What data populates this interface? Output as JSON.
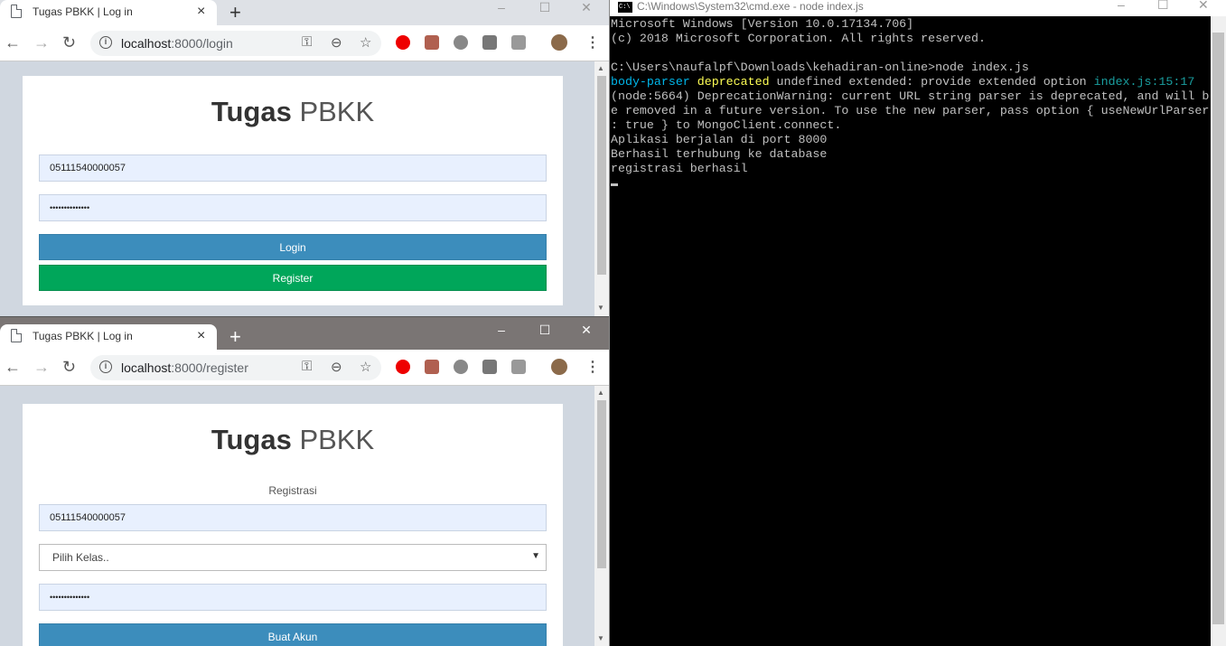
{
  "top_browser": {
    "tab_title": "Tugas PBKK | Log in",
    "url_host": "localhost",
    "url_path": ":8000/login",
    "brand_bold": "Tugas",
    "brand_light": "PBKK",
    "username_value": "05111540000057",
    "password_value": "••••••••••••••",
    "login_label": "Login",
    "register_label": "Register"
  },
  "bottom_browser": {
    "tab_title": "Tugas PBKK | Log in",
    "url_host": "localhost",
    "url_path": ":8000/register",
    "brand_bold": "Tugas",
    "brand_light": "PBKK",
    "heading": "Registrasi",
    "username_value": "05111540000057",
    "class_select_value": "Pilih Kelas..",
    "password_value": "••••••••••••••",
    "submit_label": "Buat Akun"
  },
  "terminal": {
    "title": "C:\\Windows\\System32\\cmd.exe - node  index.js",
    "lines": {
      "l1": "Microsoft Windows [Version 10.0.17134.706]",
      "l2": "(c) 2018 Microsoft Corporation. All rights reserved.",
      "l3": "",
      "l4": "C:\\Users\\naufalpf\\Downloads\\kehadiran-online>node index.js",
      "l5a": "body-parser",
      "l5b": "deprecated",
      "l5c": " undefined extended: provide extended option ",
      "l5d": "index.js:15:17",
      "l6": "(node:5664) DeprecationWarning: current URL string parser is deprecated, and will b",
      "l7": "e removed in a future version. To use the new parser, pass option { useNewUrlParser",
      "l8": ": true } to MongoClient.connect.",
      "l9": "Aplikasi berjalan di port 8000",
      "l10": "Berhasil terhubung ke database",
      "l11": "registrasi berhasil"
    }
  },
  "icons": {
    "close": "×",
    "newtab": "+",
    "minimize": "–",
    "maximize": "☐",
    "window_close": "✕",
    "back": "←",
    "forward": "→",
    "reload": "↻",
    "key": "⚿",
    "zoom": "⊖",
    "star": "☆",
    "menu": "⋮",
    "info": "i",
    "scroll_up": "▲",
    "scroll_down": "▼",
    "select_arrow": "▼",
    "cmd_icon": "C:\\"
  },
  "colors": {
    "login_blue": "#3c8dbc",
    "register_green": "#00a65a",
    "console_cyan": "#00b7eb",
    "console_yellow": "#ffff55"
  }
}
